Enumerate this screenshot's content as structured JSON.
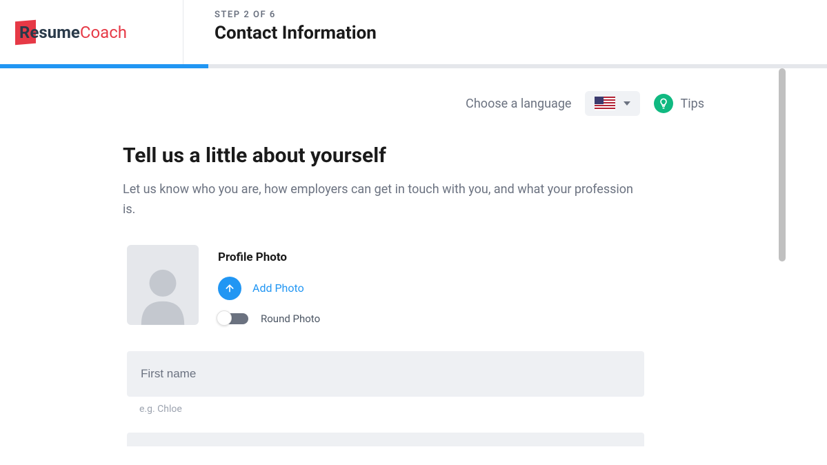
{
  "logo": {
    "part1": "Resume",
    "part2": "Coach"
  },
  "header": {
    "step_label": "STEP 2 OF 6",
    "step_title": "Contact Information"
  },
  "progress": {
    "percent": 25.2
  },
  "toolbar": {
    "lang_label": "Choose a language",
    "tips_label": "Tips",
    "selected_lang": "US"
  },
  "section": {
    "title": "Tell us a little about yourself",
    "desc": "Let us know who you are, how employers can get in touch with you, and what your profession is."
  },
  "photo": {
    "title": "Profile Photo",
    "add_label": "Add Photo",
    "round_label": "Round Photo",
    "round_enabled": false
  },
  "fields": {
    "first_name": {
      "placeholder": "First name",
      "value": "",
      "hint": "e.g. Chloe"
    }
  }
}
